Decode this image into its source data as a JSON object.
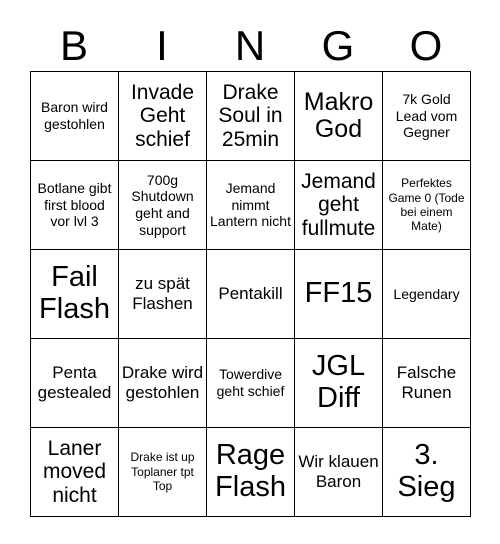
{
  "card": {
    "headers": [
      "B",
      "I",
      "N",
      "G",
      "O"
    ],
    "rows": [
      [
        {
          "text": "Baron wird gestohlen",
          "size": "sm"
        },
        {
          "text": "Invade Geht schief",
          "size": "lg"
        },
        {
          "text": "Drake Soul in 25min",
          "size": "lg"
        },
        {
          "text": "Makro God",
          "size": "xl"
        },
        {
          "text": "7k Gold Lead vom Gegner",
          "size": "sm"
        }
      ],
      [
        {
          "text": "Botlane gibt first blood vor lvl 3",
          "size": "sm"
        },
        {
          "text": "700g Shutdown geht and support",
          "size": "sm"
        },
        {
          "text": "Jemand nimmt Lantern nicht",
          "size": "sm"
        },
        {
          "text": "Jemand geht fullmute",
          "size": "lg"
        },
        {
          "text": "Perfektes Game 0 (Tode bei einem Mate)",
          "size": "xs"
        }
      ],
      [
        {
          "text": "Fail Flash",
          "size": "xxl"
        },
        {
          "text": "zu spät Flashen",
          "size": "md"
        },
        {
          "text": "Pentakill",
          "size": "md"
        },
        {
          "text": "FF15",
          "size": "xxl"
        },
        {
          "text": "Legendary",
          "size": "sm"
        }
      ],
      [
        {
          "text": "Penta gestealed",
          "size": "md"
        },
        {
          "text": "Drake wird gestohlen",
          "size": "md"
        },
        {
          "text": "Towerdive geht schief",
          "size": "sm"
        },
        {
          "text": "JGL Diff",
          "size": "xxl"
        },
        {
          "text": "Falsche Runen",
          "size": "md"
        }
      ],
      [
        {
          "text": "Laner moved nicht",
          "size": "lg"
        },
        {
          "text": "Drake ist up Toplaner tpt Top",
          "size": "xs"
        },
        {
          "text": "Rage Flash",
          "size": "xxl"
        },
        {
          "text": "Wir klauen Baron",
          "size": "md"
        },
        {
          "text": "3. Sieg",
          "size": "xxl"
        }
      ]
    ]
  }
}
